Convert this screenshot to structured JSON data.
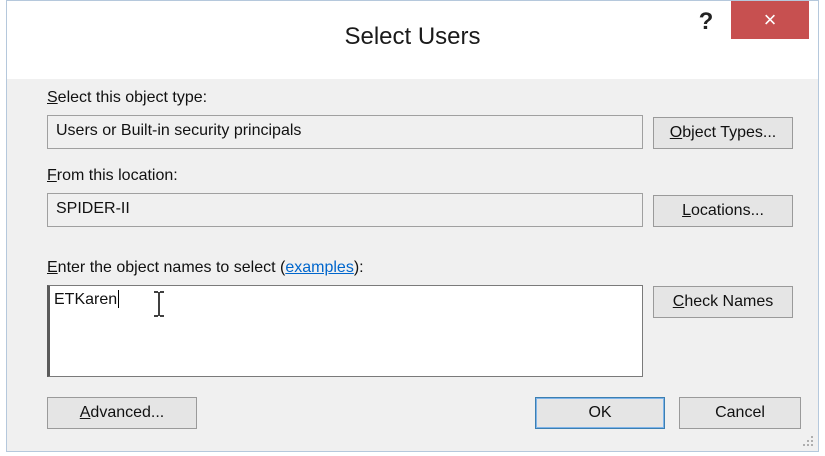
{
  "window": {
    "title": "Select Users",
    "help_label": "?",
    "close_label": "×"
  },
  "object_type": {
    "label_prefix": "S",
    "label_rest": "elect this object type:",
    "value": "Users or Built-in security principals",
    "button_prefix": "O",
    "button_rest": "bject Types..."
  },
  "location": {
    "label_prefix": "F",
    "label_rest": "rom this location:",
    "value": "SPIDER-II",
    "button_prefix": "L",
    "button_rest": "ocations..."
  },
  "names": {
    "label_prefix": "E",
    "label_rest": "nter the object names to select (",
    "examples_link": "examples",
    "label_suffix": "):",
    "value": "ETKaren",
    "check_prefix": "C",
    "check_rest": "heck Names"
  },
  "footer": {
    "advanced_prefix": "A",
    "advanced_rest": "dvanced...",
    "ok_label": "OK",
    "cancel_label": "Cancel"
  },
  "colors": {
    "close_button": "#c75050",
    "link": "#0066cc",
    "default_button_border": "#3c7fb1"
  }
}
